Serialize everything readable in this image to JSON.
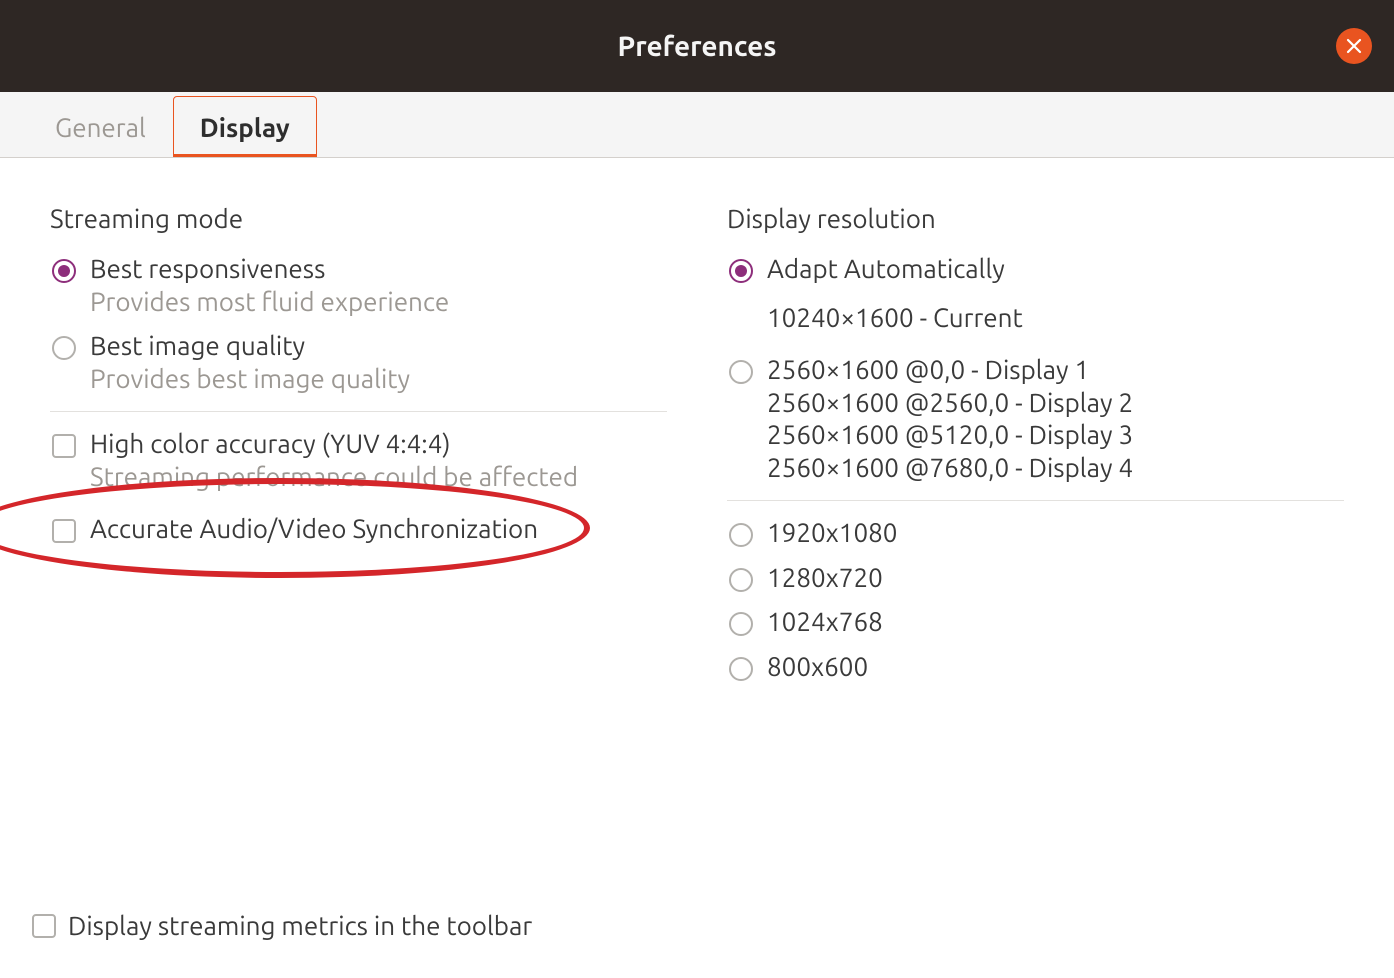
{
  "window": {
    "title": "Preferences"
  },
  "tabs": [
    {
      "label": "General",
      "active": false
    },
    {
      "label": "Display",
      "active": true
    }
  ],
  "streaming": {
    "title": "Streaming mode",
    "options": [
      {
        "label": "Best responsiveness",
        "sub": "Provides most fluid experience",
        "selected": true
      },
      {
        "label": "Best image quality",
        "sub": "Provides best image quality",
        "selected": false
      }
    ],
    "color_accuracy": {
      "label": "High color accuracy (YUV 4:4:4)",
      "sub": "Streaming performance could be affected",
      "checked": false
    },
    "av_sync": {
      "label": "Accurate Audio/Video Synchronization",
      "checked": false
    }
  },
  "resolution": {
    "title": "Display resolution",
    "adapt": {
      "label": "Adapt Automatically",
      "selected": true,
      "current": "10240×1600 - Current"
    },
    "display_group": {
      "selected": false,
      "lines": [
        "2560×1600 @0,0 - Display 1",
        "2560×1600 @2560,0 - Display 2",
        "2560×1600 @5120,0 - Display 3",
        "2560×1600 @7680,0 - Display 4"
      ]
    },
    "fixed": [
      {
        "label": "1920x1080",
        "selected": false
      },
      {
        "label": "1280x720",
        "selected": false
      },
      {
        "label": "1024x768",
        "selected": false
      },
      {
        "label": "800x600",
        "selected": false
      }
    ]
  },
  "metrics": {
    "label": "Display streaming metrics in the toolbar",
    "checked": false
  },
  "colors": {
    "accent": "#e95420",
    "radio_selected": "#8d2e7b",
    "annotation": "#d4262a"
  }
}
